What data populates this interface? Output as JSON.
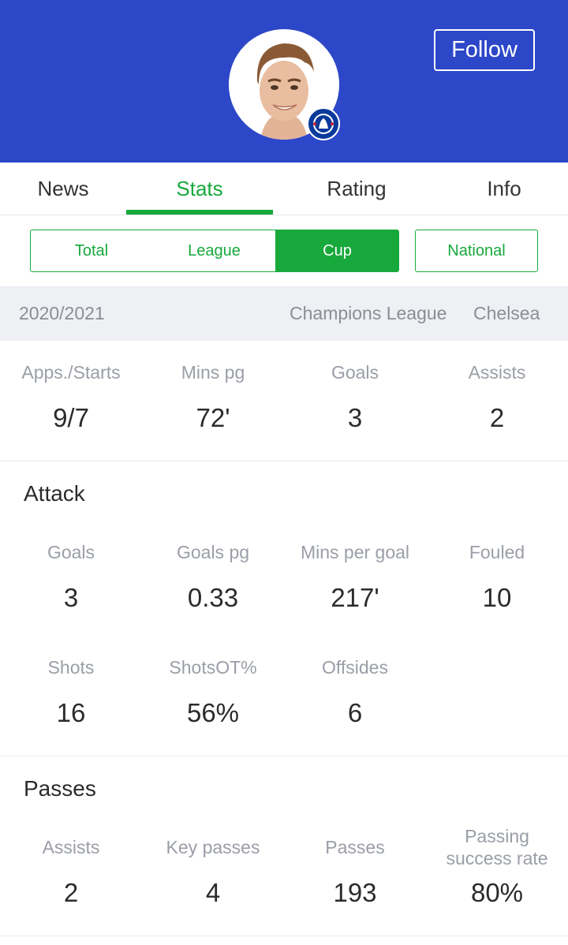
{
  "header": {
    "follow_label": "Follow",
    "background_color": "#2c47c8"
  },
  "tabs": [
    {
      "label": "News"
    },
    {
      "label": "Stats"
    },
    {
      "label": "Rating"
    },
    {
      "label": "Info"
    }
  ],
  "active_tab": "Stats",
  "segments": [
    {
      "label": "Total"
    },
    {
      "label": "League"
    },
    {
      "label": "Cup"
    },
    {
      "label": "National"
    }
  ],
  "active_segment": "Cup",
  "accent_color": "#17a93c",
  "season": {
    "year": "2020/2021",
    "competition": "Champions League",
    "club": "Chelsea"
  },
  "summary": [
    {
      "label": "Apps./Starts",
      "value": "9/7"
    },
    {
      "label": "Mins pg",
      "value": "72'"
    },
    {
      "label": "Goals",
      "value": "3"
    },
    {
      "label": "Assists",
      "value": "2"
    }
  ],
  "attack": {
    "title": "Attack",
    "stats": [
      {
        "label": "Goals",
        "value": "3"
      },
      {
        "label": "Goals pg",
        "value": "0.33"
      },
      {
        "label": "Mins per goal",
        "value": "217'"
      },
      {
        "label": "Fouled",
        "value": "10"
      },
      {
        "label": "Shots",
        "value": "16"
      },
      {
        "label": "ShotsOT%",
        "value": "56%"
      },
      {
        "label": "Offsides",
        "value": "6"
      }
    ]
  },
  "passes": {
    "title": "Passes",
    "stats": [
      {
        "label": "Assists",
        "value": "2"
      },
      {
        "label": "Key passes",
        "value": "4"
      },
      {
        "label": "Passes",
        "value": "193"
      },
      {
        "label": "Passing success rate",
        "value": "80%"
      }
    ]
  }
}
